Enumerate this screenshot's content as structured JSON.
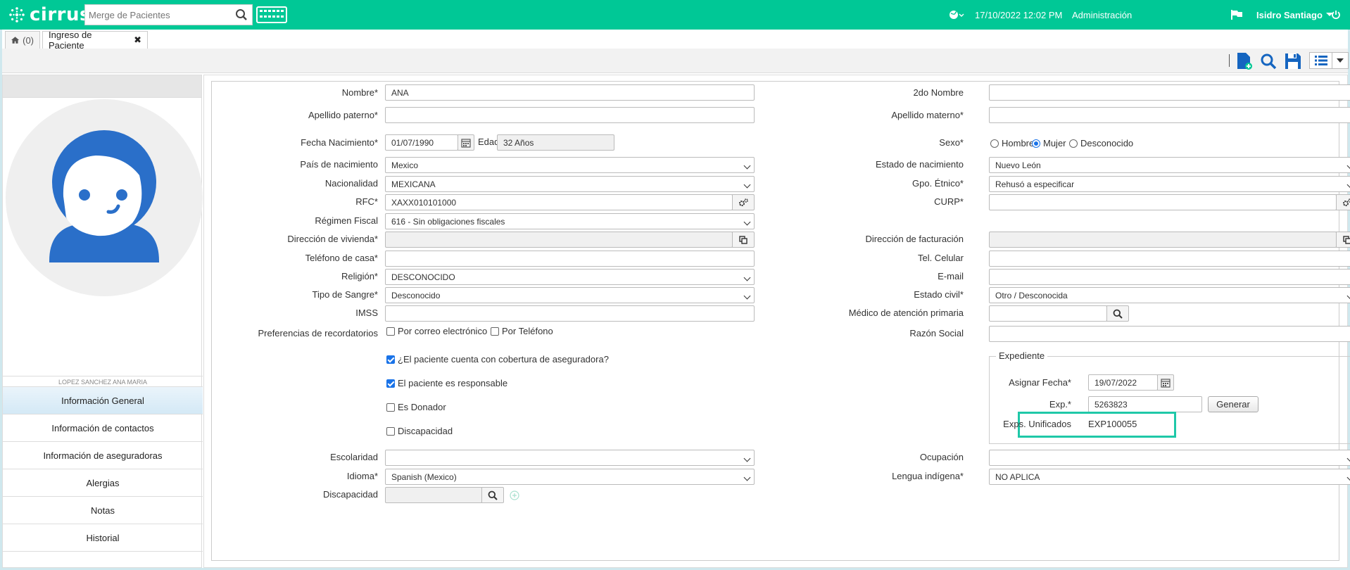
{
  "app": {
    "logo_text": "cirrus",
    "brand_color": "#00c896"
  },
  "header": {
    "search_placeholder": "Merge de Pacientes",
    "datetime": "17/10/2022 12:02 PM",
    "role": "Administración",
    "user_name": "Isidro Santiago"
  },
  "tabs": {
    "home_count": "(0)",
    "active_label": "Ingreso de Paciente"
  },
  "sidebar": {
    "patient_name": "LOPEZ SANCHEZ ANA MARIA",
    "items": [
      {
        "label": "Información General"
      },
      {
        "label": "Información de contactos"
      },
      {
        "label": "Información de aseguradoras"
      },
      {
        "label": "Alergias"
      },
      {
        "label": "Notas"
      },
      {
        "label": "Historial"
      }
    ]
  },
  "form": {
    "nombre_label": "Nombre*",
    "nombre_value": "ANA",
    "segundo_nombre_label": "2do Nombre",
    "segundo_nombre_value": "",
    "apellido_paterno_label": "Apellido paterno*",
    "apellido_paterno_value": "",
    "apellido_materno_label": "Apellido materno*",
    "apellido_materno_value": "",
    "fecha_nac_label": "Fecha Nacimiento*",
    "fecha_nac_value": "01/07/1990",
    "edad_label": "Edad",
    "edad_value": "32 Años",
    "sexo_label": "Sexo*",
    "sexo_options": [
      "Hombre",
      "Mujer",
      "Desconocido"
    ],
    "sexo_selected": "Mujer",
    "pais_nac_label": "País de nacimiento",
    "pais_nac_value": "Mexico",
    "estado_nac_label": "Estado de nacimiento",
    "estado_nac_value": "Nuevo León",
    "nacionalidad_label": "Nacionalidad",
    "nacionalidad_value": "MEXICANA",
    "grupo_etnico_label": "Gpo. Étnico*",
    "grupo_etnico_value": "Rehusó a especificar",
    "rfc_label": "RFC*",
    "rfc_value": "XAXX010101000",
    "curp_label": "CURP*",
    "curp_value": "",
    "regimen_label": "Régimen Fiscal",
    "regimen_value": "616 - Sin obligaciones fiscales",
    "dir_vivienda_label": "Dirección de vivienda*",
    "dir_facturacion_label": "Dirección de facturación",
    "tel_casa_label": "Teléfono de casa*",
    "tel_celular_label": "Tel. Celular",
    "religion_label": "Religión*",
    "religion_value": "DESCONOCIDO",
    "email_label": "E-mail",
    "tipo_sangre_label": "Tipo de Sangre*",
    "tipo_sangre_value": "Desconocido",
    "estado_civil_label": "Estado civil*",
    "estado_civil_value": "Otro / Desconocida",
    "imss_label": "IMSS",
    "medico_label": "Médico de atención primaria",
    "pref_label": "Preferencias de recordatorios",
    "pref_email": "Por correo electrónico",
    "pref_tel": "Por Teléfono",
    "razon_social_label": "Razón Social",
    "chk_cobertura": "¿El paciente cuenta con cobertura de aseguradora?",
    "chk_responsable": "El paciente es responsable",
    "chk_donador": "Es Donador",
    "chk_discapacidad": "Discapacidad",
    "escolaridad_label": "Escolaridad",
    "ocupacion_label": "Ocupación",
    "idioma_label": "Idioma*",
    "idioma_value": "Spanish (Mexico)",
    "lengua_label": "Lengua indígena*",
    "lengua_value": "NO APLICA",
    "discapacidad_label": "Discapacidad"
  },
  "expediente": {
    "legend": "Expediente",
    "asignar_fecha_label": "Asignar Fecha*",
    "asignar_fecha_value": "19/07/2022",
    "exp_label": "Exp.*",
    "exp_value": "5263823",
    "generar_label": "Generar",
    "unificados_label": "Exps. Unificados",
    "unificados_value": "EXP100055",
    "highlight_color": "#1fc8a8"
  }
}
